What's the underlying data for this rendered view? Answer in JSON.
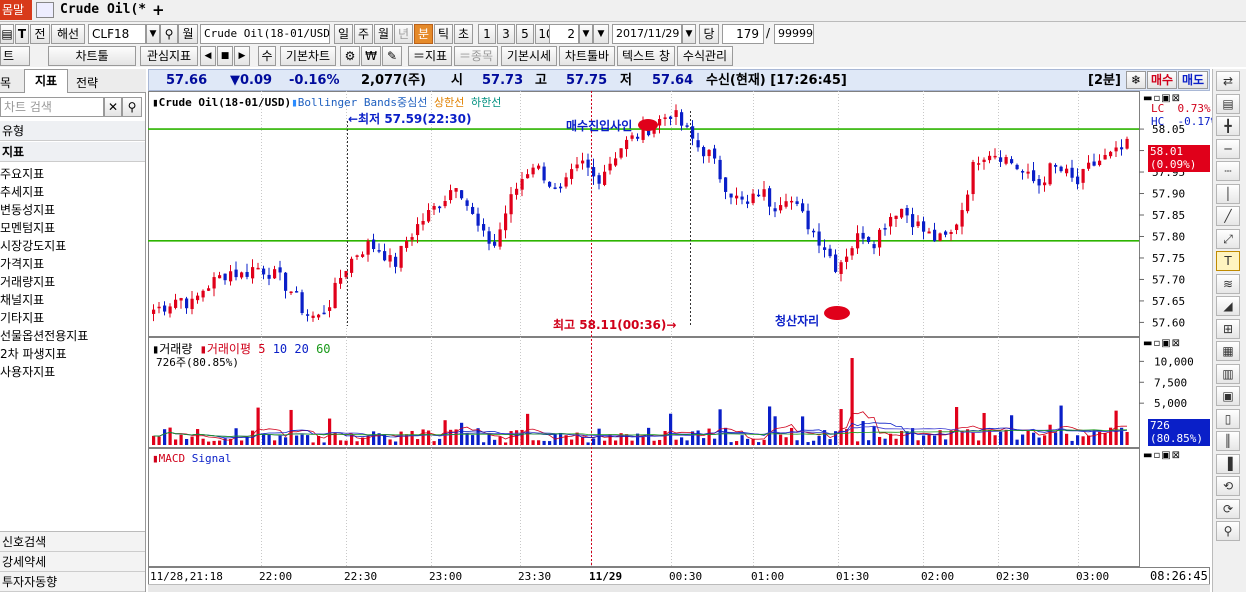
{
  "window": {
    "prev_tab": "몸말",
    "tab_title": "Crude Oil(*",
    "add_tab": "+"
  },
  "toolbar1": {
    "btn_jeon": "전",
    "btn_haeseon": "해선",
    "symbol": "CLF18",
    "btn_month": "월",
    "instrument_name": "Crude Oil(18-01/USD)",
    "periods": [
      "일",
      "주",
      "월",
      "년",
      "분",
      "틱",
      "초"
    ],
    "active_period": "분",
    "nums": [
      "1",
      "3",
      "5",
      "10"
    ],
    "interval": "2",
    "date": "2017/11/29",
    "btn_dang": "당",
    "count": "179",
    "separator": "/",
    "max_count": "99999"
  },
  "toolbar2": {
    "btn_t": "트",
    "btn_chart_tool": "차트툴",
    "btn_watch": "관심지표",
    "btn_su": "수",
    "btn_basic_chart": "기본차트",
    "btn_add_indicator": "＝지표",
    "btn_add_item": "＝종목",
    "btn_basic_price": "기본시세",
    "btn_chart_toolbar": "차트툴바",
    "btn_text_window": "텍스트 창",
    "btn_formula": "수식관리"
  },
  "sidebar": {
    "tabs": [
      "목",
      "지표",
      "전략"
    ],
    "active_tab": "지표",
    "search_placeholder": "차트 검색",
    "group_type": "유형",
    "group_indicator": "지표",
    "items": [
      "주요지표",
      "추세지표",
      "변동성지표",
      "모멘텀지표",
      "시장강도지표",
      "가격지표",
      "거래량지표",
      "채널지표",
      "기타지표",
      "선물옵션전용지표",
      "2차 파생지표",
      "사용자지표"
    ],
    "bottom": [
      "신호검색",
      "강세약세",
      "투자자동향"
    ]
  },
  "quote": {
    "last": "57.66",
    "change": "▼0.09",
    "change_pct": "-0.16%",
    "volume": "2,077(주)",
    "open_label": "시",
    "open": "57.73",
    "high_label": "고",
    "high": "57.75",
    "low_label": "저",
    "low": "57.64",
    "status": "수신(현재) [17:26:45]",
    "period": "[2분]",
    "buy": "매수",
    "sell": "매도"
  },
  "chart": {
    "legend_name": "Crude Oil(18-01/USD)",
    "legend_bb": "Bollinger Bands중심선",
    "legend_upper": "상한선",
    "legend_lower": "하한선",
    "annot_low": "←최저 57.59(22:30)",
    "annot_high": "최고 58.11(00:36)→",
    "annot_buy": "매수진입사인",
    "annot_exit": "청산자리",
    "lc_label": "LC",
    "lc_value": "0.73%",
    "hc_label": "HC",
    "hc_value": "-0.17%",
    "current_price": "58.01",
    "current_pct": "(0.09%)",
    "price_ticks": [
      "58.05",
      "58.00",
      "57.95",
      "57.90",
      "57.85",
      "57.80",
      "57.75",
      "57.70",
      "57.65",
      "57.60"
    ],
    "volume_legend": "거래량",
    "volume_ma": "거래이평",
    "volume_ma_periods": [
      "5",
      "10",
      "20",
      "60"
    ],
    "volume_info": "726주(80.85%)",
    "volume_ticks": [
      "10,000",
      "7,500",
      "5,000"
    ],
    "volume_current": "726",
    "volume_current_pct": "(80.85%)",
    "macd_legend": "MACD",
    "macd_signal": "Signal",
    "time_labels": [
      "11/28,21:18",
      "22:00",
      "22:30",
      "23:00",
      "23:30",
      "11/29",
      "00:30",
      "01:00",
      "01:30",
      "02:00",
      "02:30",
      "03:00"
    ],
    "clock": "08:26:45"
  },
  "colors": {
    "up": "#e0001a",
    "down": "#0a1fc8",
    "band": "#2db400",
    "header_bg": "#dfe8f7",
    "accent_tab": "#e58a2a"
  },
  "chart_data": {
    "type": "candlestick",
    "title": "Crude Oil(18-01/USD)",
    "ylim": [
      57.58,
      58.12
    ],
    "upper_band": 58.05,
    "lower_band": 57.79,
    "low_point": {
      "value": 57.59,
      "time": "22:30"
    },
    "high_point": {
      "value": 58.11,
      "time": "00:36"
    },
    "volume_ylim": [
      0,
      11000
    ],
    "close_path": [
      57.63,
      57.64,
      57.66,
      57.64,
      57.68,
      57.7,
      57.72,
      57.71,
      57.73,
      57.72,
      57.7,
      57.67,
      57.62,
      57.61,
      57.65,
      57.72,
      57.76,
      57.78,
      57.77,
      57.73,
      57.79,
      57.83,
      57.86,
      57.89,
      57.93,
      57.86,
      57.8,
      57.78,
      57.87,
      57.93,
      57.97,
      57.94,
      57.89,
      57.94,
      57.97,
      57.93,
      57.97,
      58.01,
      58.03,
      58.05,
      58.07,
      58.09,
      58.05,
      58.01,
      57.99,
      57.93,
      57.89,
      57.87,
      57.91,
      57.87,
      57.9,
      57.86,
      57.82,
      57.78,
      57.73,
      57.77,
      57.81,
      57.79,
      57.84,
      57.87,
      57.84,
      57.81,
      57.79,
      57.8,
      57.87,
      57.98,
      58.0,
      57.99,
      57.97,
      57.94,
      57.92,
      57.96,
      57.95,
      57.92,
      57.96,
      57.98,
      57.99,
      58.01
    ]
  }
}
